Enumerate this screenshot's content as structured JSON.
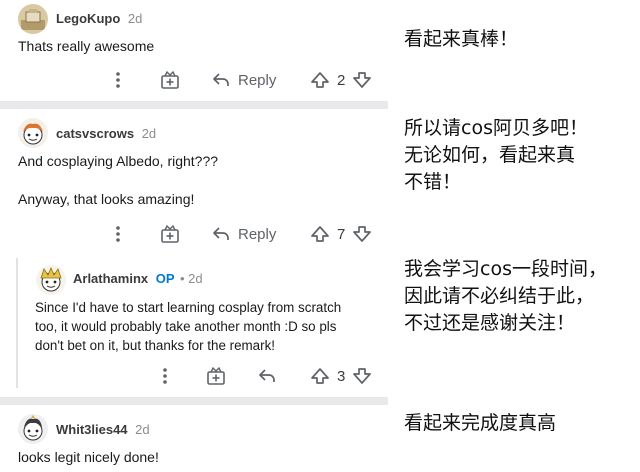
{
  "comments": [
    {
      "username": "LegoKupo",
      "op_badge": "",
      "time": "2d",
      "lines": [
        "Thats really awesome"
      ],
      "reply_label": "Reply",
      "vote_count": "2",
      "avatar_icon": "snoo-avatar-icon"
    },
    {
      "username": "catsvscrows",
      "op_badge": "",
      "time": "2d",
      "lines": [
        "And cosplaying Albedo, right???",
        "",
        "Anyway, that looks amazing!"
      ],
      "reply_label": "Reply",
      "vote_count": "7",
      "avatar_icon": "snoo-avatar-icon"
    },
    {
      "username": "Arlathaminx",
      "op_badge": "OP",
      "time": "2d",
      "lines": [
        "Since I'd have to start learning cosplay from scratch",
        "too, it would probably take another month :D so pls",
        "don't bet on it, but thanks for the remark!"
      ],
      "reply_label": "",
      "vote_count": "3",
      "avatar_icon": "snoo-avatar-icon"
    },
    {
      "username": "Whit3lies44",
      "op_badge": "",
      "time": "2d",
      "lines": [
        "looks legit nicely done!"
      ],
      "avatar_icon": "snoo-avatar-icon"
    }
  ],
  "annotations": {
    "a1": [
      "看起来真棒！"
    ],
    "a2": [
      "所以请cos阿贝多吧！",
      "无论如何，看起来真",
      "不错！"
    ],
    "a3": [
      "我会学习cos一段时间，",
      "因此请不必纠结于此，",
      "不过还是感谢关注！"
    ],
    "a4": [
      "看起来完成度真高"
    ]
  },
  "colors": {
    "op_badge": "#0079d3",
    "icon_gray": "#5f6368",
    "separator": "#e9e9ec",
    "thread_line": "#e2e2e5"
  }
}
